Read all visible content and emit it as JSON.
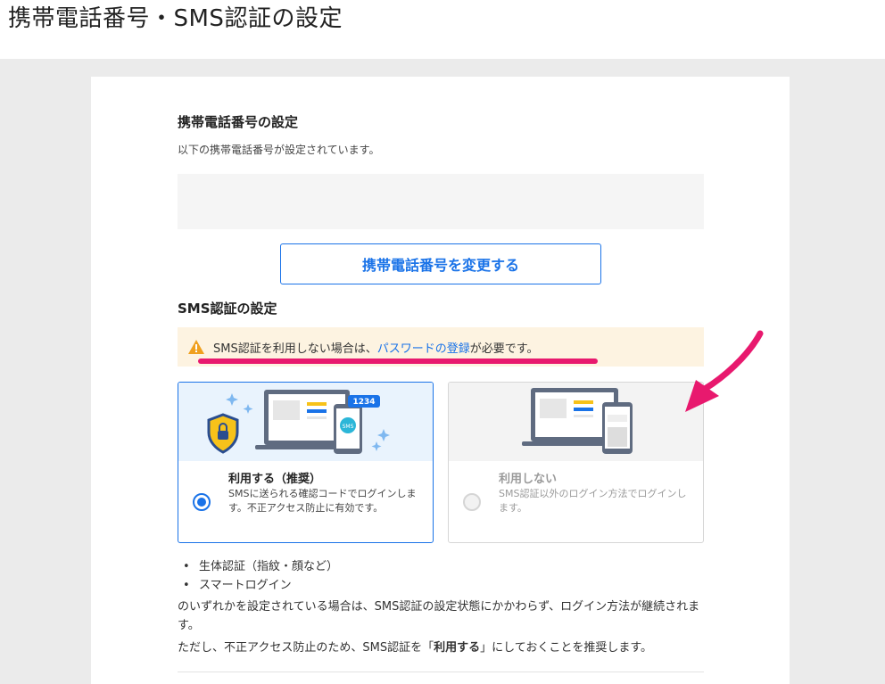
{
  "page": {
    "title": "携帯電話番号・SMS認証の設定"
  },
  "phone_section": {
    "heading": "携帯電話番号の設定",
    "description": "以下の携帯電話番号が設定されています。",
    "change_button": "携帯電話番号を変更する"
  },
  "sms_section": {
    "heading": "SMS認証の設定",
    "warning": {
      "icon": "warning-icon",
      "prefix": "SMS認証を利用しない場合は、",
      "link": "パスワードの登録",
      "suffix": "が必要です。"
    },
    "options": [
      {
        "title": "利用する（推奨）",
        "description": "SMSに送られる確認コードでログインします。不正アクセス防止に有効です。",
        "selected": true,
        "badge_code": "1234",
        "badge_sms": "SMS"
      },
      {
        "title": "利用しない",
        "description": "SMS認証以外のログイン方法でログインします。",
        "selected": false
      }
    ],
    "bullets": [
      "生体認証（指紋・顔など）",
      "スマートログイン"
    ],
    "note1": "のいずれかを設定されている場合は、SMS認証の設定状態にかかわらず、ログイン方法が継続されます。",
    "note2_prefix": "ただし、不正アクセス防止のため、SMS認証を「",
    "note2_bold": "利用する",
    "note2_suffix": "」にしておくことを推奨します。"
  },
  "colors": {
    "accent": "#1a73e8",
    "highlight": "#e8196e",
    "warning_bg": "#fdf3e1",
    "warning_icon": "#f0a01e"
  }
}
